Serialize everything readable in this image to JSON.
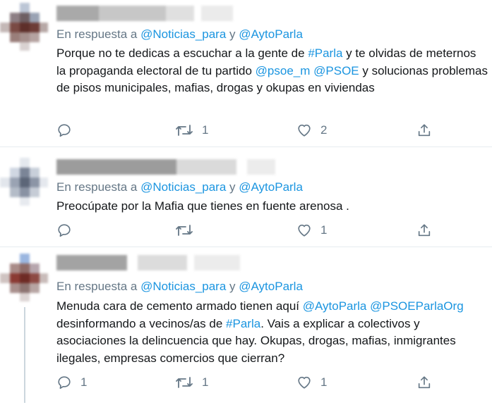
{
  "tweets": [
    {
      "reply_prefix": "En respuesta a",
      "reply_mention_1": "@Noticias_para",
      "reply_and": "y",
      "reply_mention_2": "@AytoParla",
      "text": [
        {
          "t": "Porque no te dedicas a escuchar a la gente de ",
          "m": false
        },
        {
          "t": "#Parla",
          "m": true
        },
        {
          "t": " y te olvidas de meternos la propaganda electoral de tu partido ",
          "m": false
        },
        {
          "t": "@psoe_m",
          "m": true
        },
        {
          "t": " ",
          "m": false
        },
        {
          "t": "@PSOE",
          "m": true
        },
        {
          "t": " y solucionas problemas de pisos municipales, mafias, drogas y okupas en viviendas",
          "m": false
        }
      ],
      "reply_count": "",
      "retweet_count": "1",
      "like_count": "2"
    },
    {
      "reply_prefix": "En respuesta a",
      "reply_mention_1": "@Noticias_para",
      "reply_and": "y",
      "reply_mention_2": "@AytoParla",
      "text": [
        {
          "t": "Preocúpate por la Mafia  que tienes en fuente arenosa .",
          "m": false
        }
      ],
      "reply_count": "",
      "retweet_count": "",
      "like_count": "1"
    },
    {
      "reply_prefix": "En respuesta a",
      "reply_mention_1": "@Noticias_para",
      "reply_and": "y",
      "reply_mention_2": "@AytoParla",
      "text": [
        {
          "t": "Menuda cara de cemento armado tienen aquí ",
          "m": false
        },
        {
          "t": "@AytoParla",
          "m": true
        },
        {
          "t": " ",
          "m": false
        },
        {
          "t": "@PSOEParlaOrg",
          "m": true
        },
        {
          "t": " desinformando a vecinos/as de ",
          "m": false
        },
        {
          "t": "#Parla",
          "m": true
        },
        {
          "t": ". Vais a explicar a colectivos y asociaciones la delincuencia que hay. Okupas, drogas, mafias, inmigrantes ilegales, empresas comercios que cierran?",
          "m": false
        }
      ],
      "reply_count": "1",
      "retweet_count": "1",
      "like_count": "1"
    }
  ],
  "icons": {
    "reply": "reply-icon",
    "retweet": "retweet-icon",
    "like": "heart-icon",
    "share": "share-icon"
  },
  "colors": {
    "text": "#14171a",
    "muted": "#657786",
    "link": "#1b95e0",
    "divider": "#e6ecf0"
  }
}
